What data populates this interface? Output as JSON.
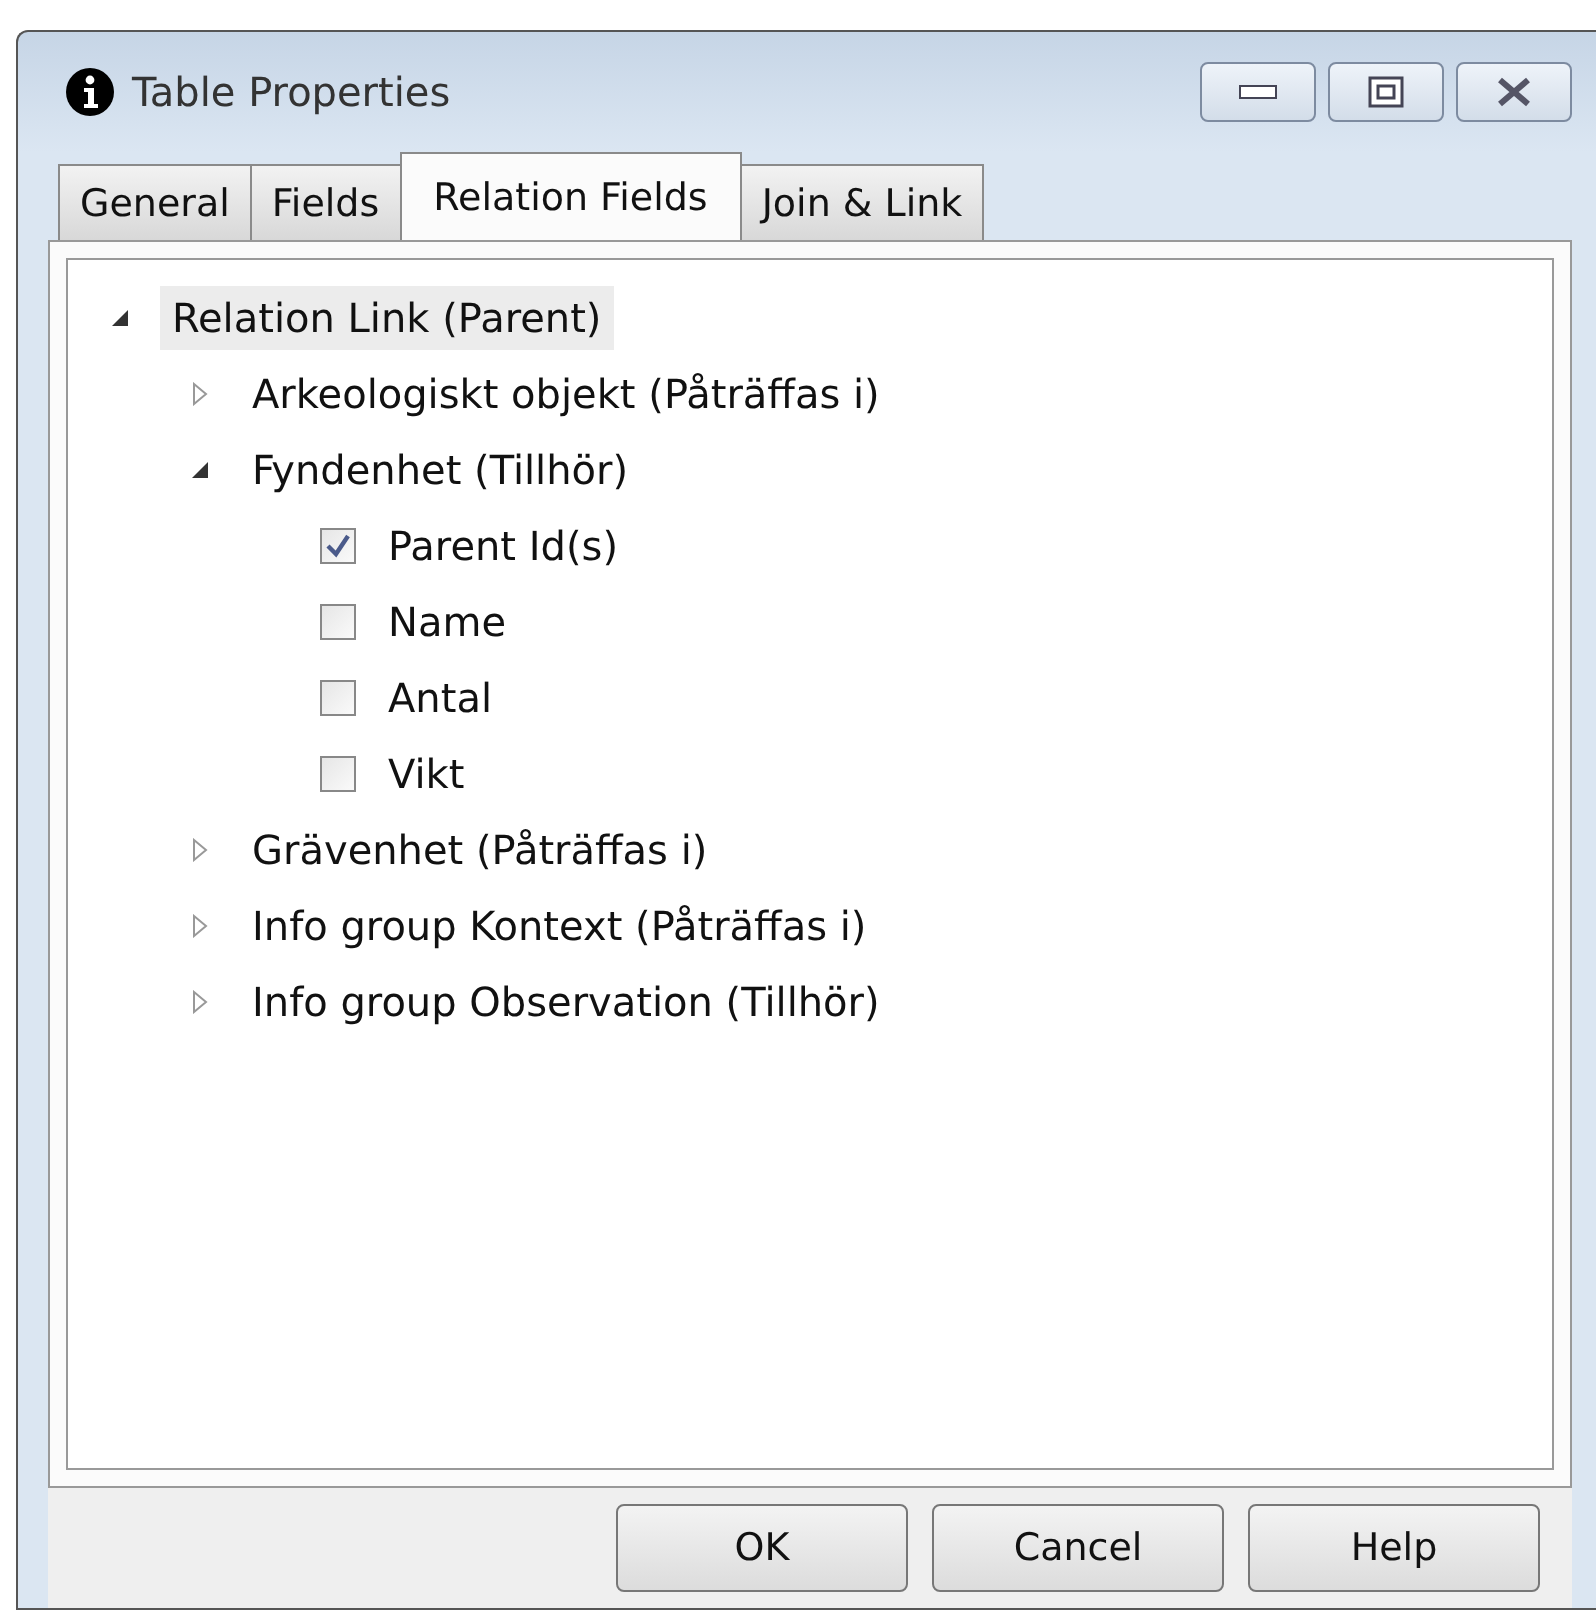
{
  "window": {
    "title": "Table Properties"
  },
  "tabs": [
    {
      "label": "General",
      "selected": false
    },
    {
      "label": "Fields",
      "selected": false
    },
    {
      "label": "Relation Fields",
      "selected": true
    },
    {
      "label": "Join & Link",
      "selected": false
    }
  ],
  "tree": [
    {
      "kind": "node",
      "label": "Relation Link (Parent)",
      "expanded": true,
      "selected": true,
      "children": [
        {
          "kind": "node",
          "label": "Arkeologiskt objekt (Påträffas i)",
          "expanded": false,
          "selected": false
        },
        {
          "kind": "node",
          "label": "Fyndenhet (Tillhör)",
          "expanded": true,
          "selected": false,
          "children": [
            {
              "kind": "checkbox",
              "label": "Parent Id(s)",
              "checked": true
            },
            {
              "kind": "checkbox",
              "label": "Name",
              "checked": false
            },
            {
              "kind": "checkbox",
              "label": "Antal",
              "checked": false
            },
            {
              "kind": "checkbox",
              "label": "Vikt",
              "checked": false
            }
          ]
        },
        {
          "kind": "node",
          "label": "Grävenhet (Påträffas i)",
          "expanded": false,
          "selected": false
        },
        {
          "kind": "node",
          "label": "Info group Kontext (Påträffas i)",
          "expanded": false,
          "selected": false
        },
        {
          "kind": "node",
          "label": "Info group Observation (Tillhör)",
          "expanded": false,
          "selected": false
        }
      ]
    }
  ],
  "buttons": [
    "OK",
    "Cancel",
    "Help"
  ]
}
